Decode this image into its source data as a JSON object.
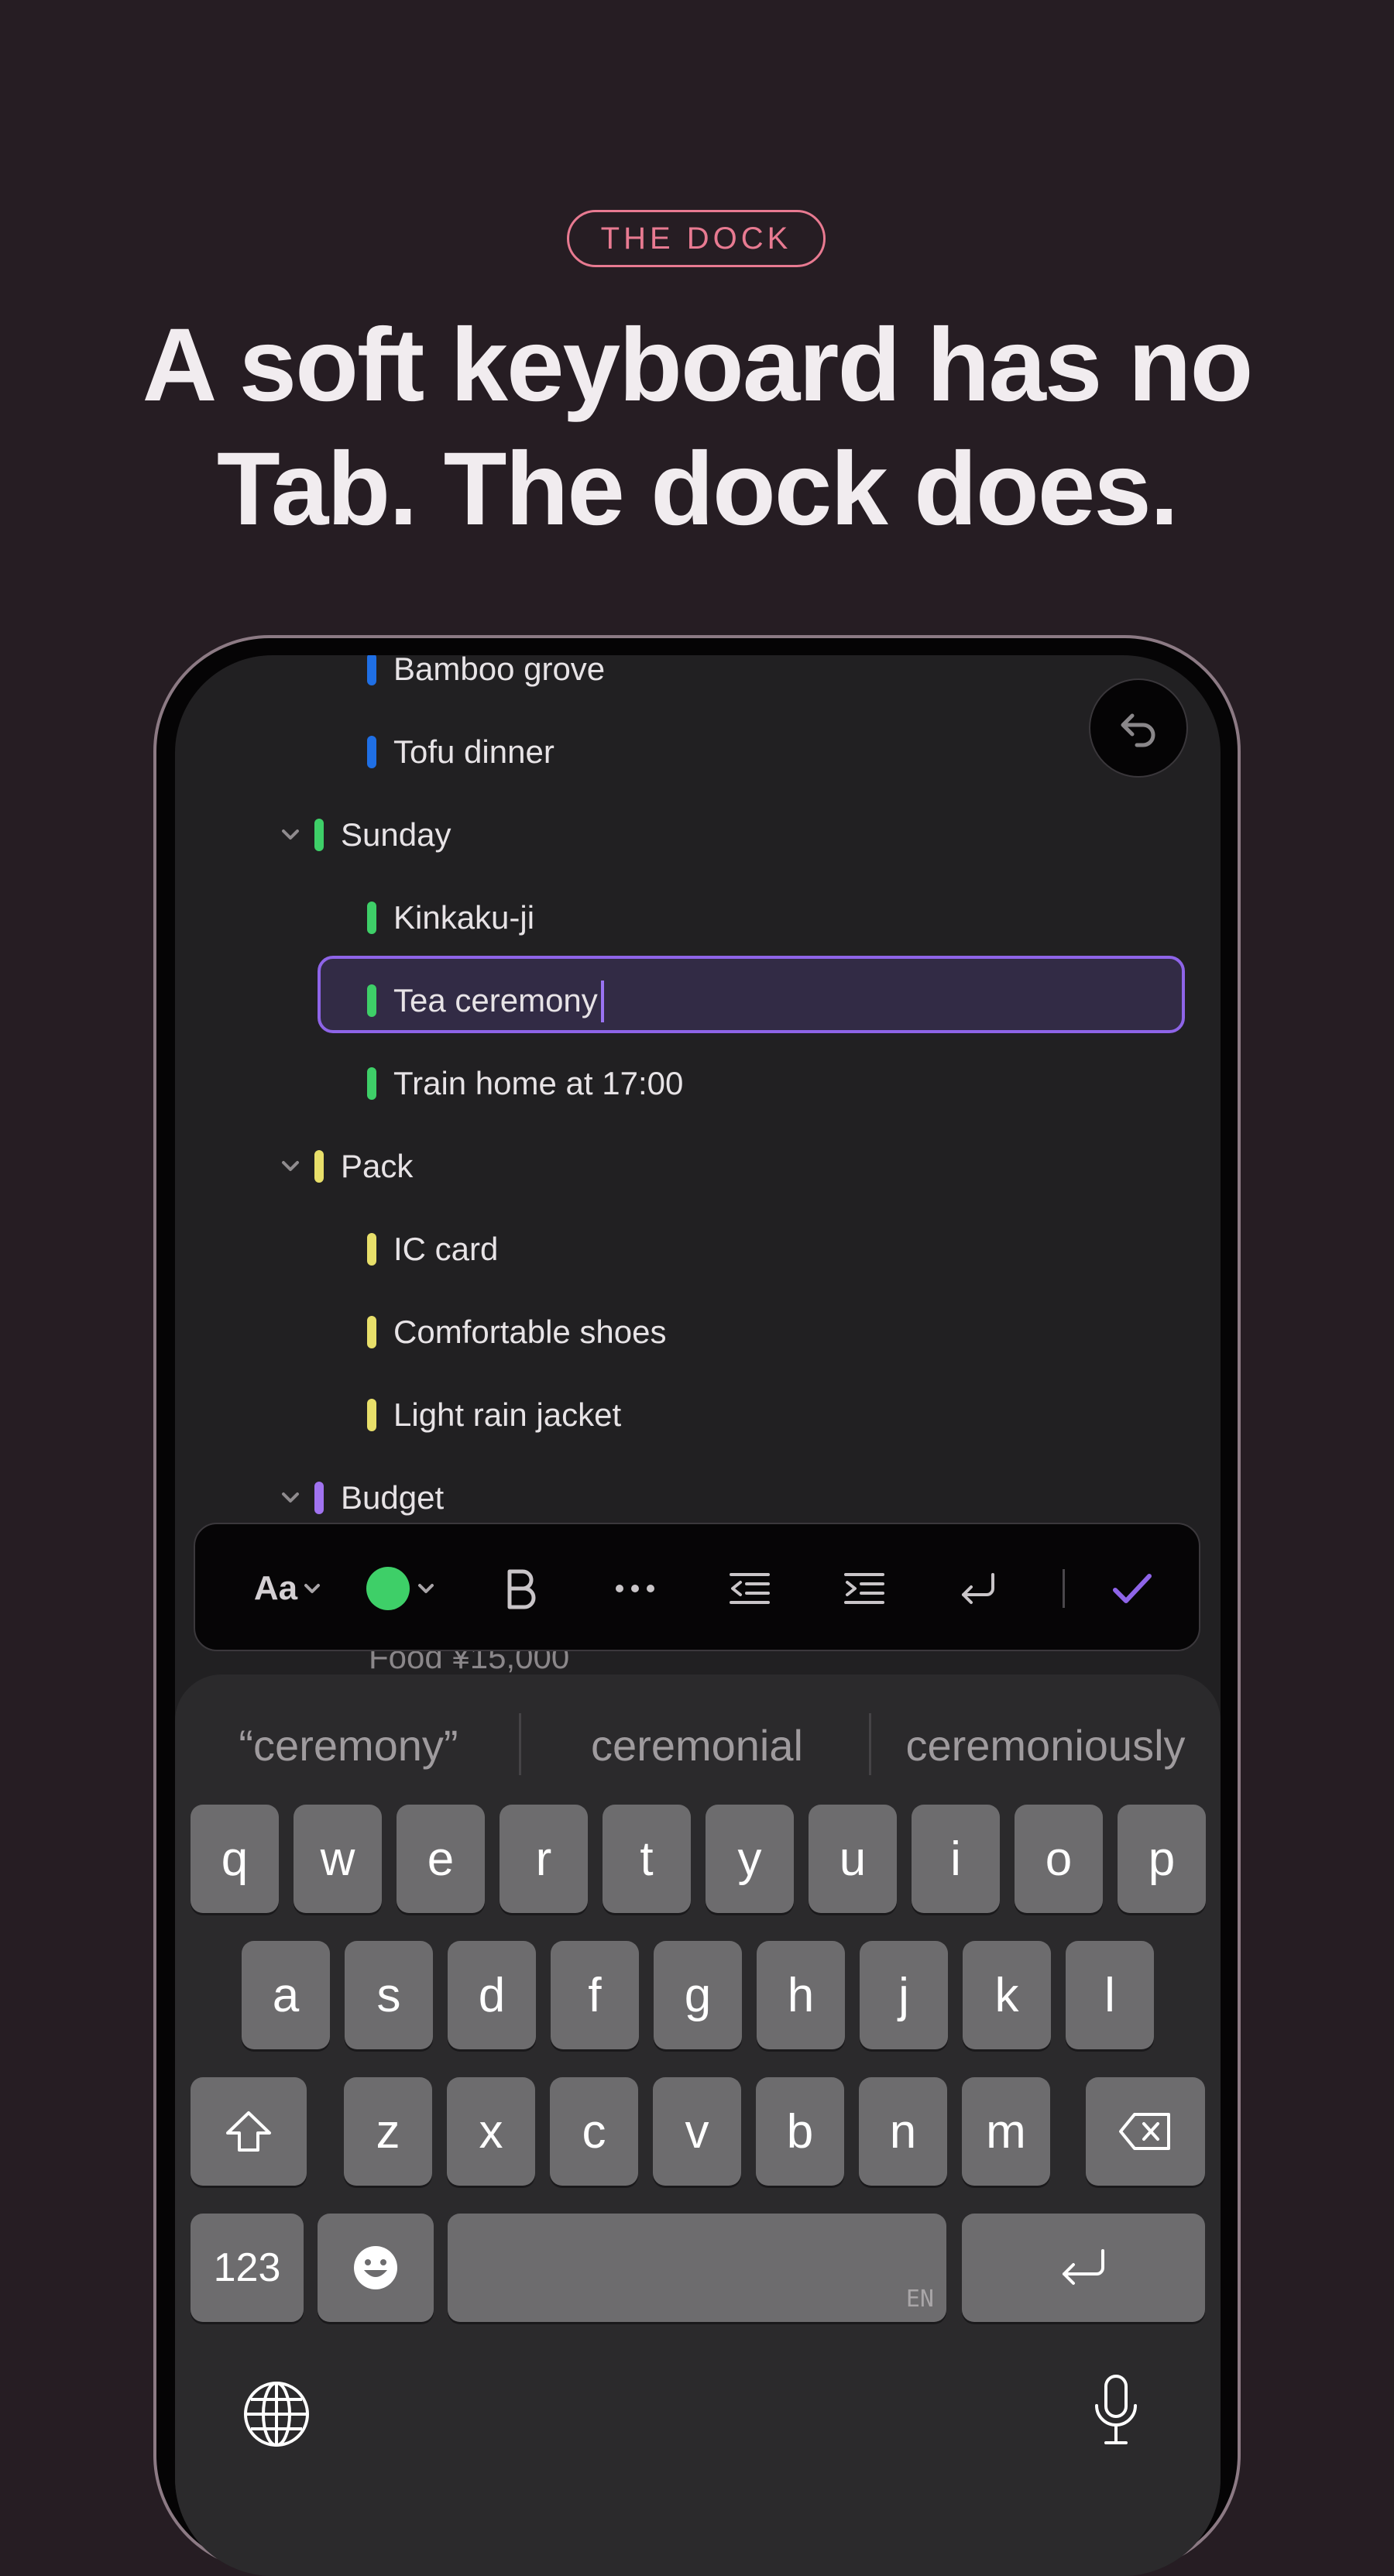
{
  "badge": "THE DOCK",
  "headline": {
    "line1": "A soft keyboard has no",
    "line2": "Tab. The dock does."
  },
  "outline": {
    "rows": [
      {
        "text": "Bamboo grove",
        "color": "#1f6fe5",
        "level": 2
      },
      {
        "text": "Tofu dinner",
        "color": "#1f6fe5",
        "level": 2
      },
      {
        "text": "Sunday",
        "color": "#3ecf68",
        "level": 1,
        "expanded": true
      },
      {
        "text": "Kinkaku-ji",
        "color": "#3ecf68",
        "level": 2
      },
      {
        "text": "Tea ceremony",
        "color": "#3ecf68",
        "level": 2,
        "focused": true
      },
      {
        "text": "Train home at 17:00",
        "color": "#3ecf68",
        "level": 2
      },
      {
        "text": "Pack",
        "color": "#e8df6a",
        "level": 1,
        "expanded": true
      },
      {
        "text": "IC card",
        "color": "#e8df6a",
        "level": 2
      },
      {
        "text": "Comfortable shoes",
        "color": "#e8df6a",
        "level": 2
      },
      {
        "text": "Light rain jacket",
        "color": "#e8df6a",
        "level": 2
      },
      {
        "text": "Budget",
        "color": "#a173f0",
        "level": 1,
        "expanded": true
      }
    ],
    "partially_hidden_row": "Food ¥15,000"
  },
  "dock": {
    "text_style_label": "Aa",
    "color_swatch": "#3ecf68",
    "accent": "#8e64e8",
    "icons": [
      "text-style-icon",
      "color-swatch-icon",
      "bold-icon",
      "more-icon",
      "outdent-icon",
      "indent-icon",
      "return-icon",
      "done-check-icon"
    ]
  },
  "keyboard": {
    "suggestions": [
      "“ceremony”",
      "ceremonial",
      "ceremoniously"
    ],
    "row1": [
      "q",
      "w",
      "e",
      "r",
      "t",
      "y",
      "u",
      "i",
      "o",
      "p"
    ],
    "row2": [
      "a",
      "s",
      "d",
      "f",
      "g",
      "h",
      "j",
      "k",
      "l"
    ],
    "row3": [
      "z",
      "x",
      "c",
      "v",
      "b",
      "n",
      "m"
    ],
    "numbers_key": "123",
    "space_lang": "EN"
  }
}
